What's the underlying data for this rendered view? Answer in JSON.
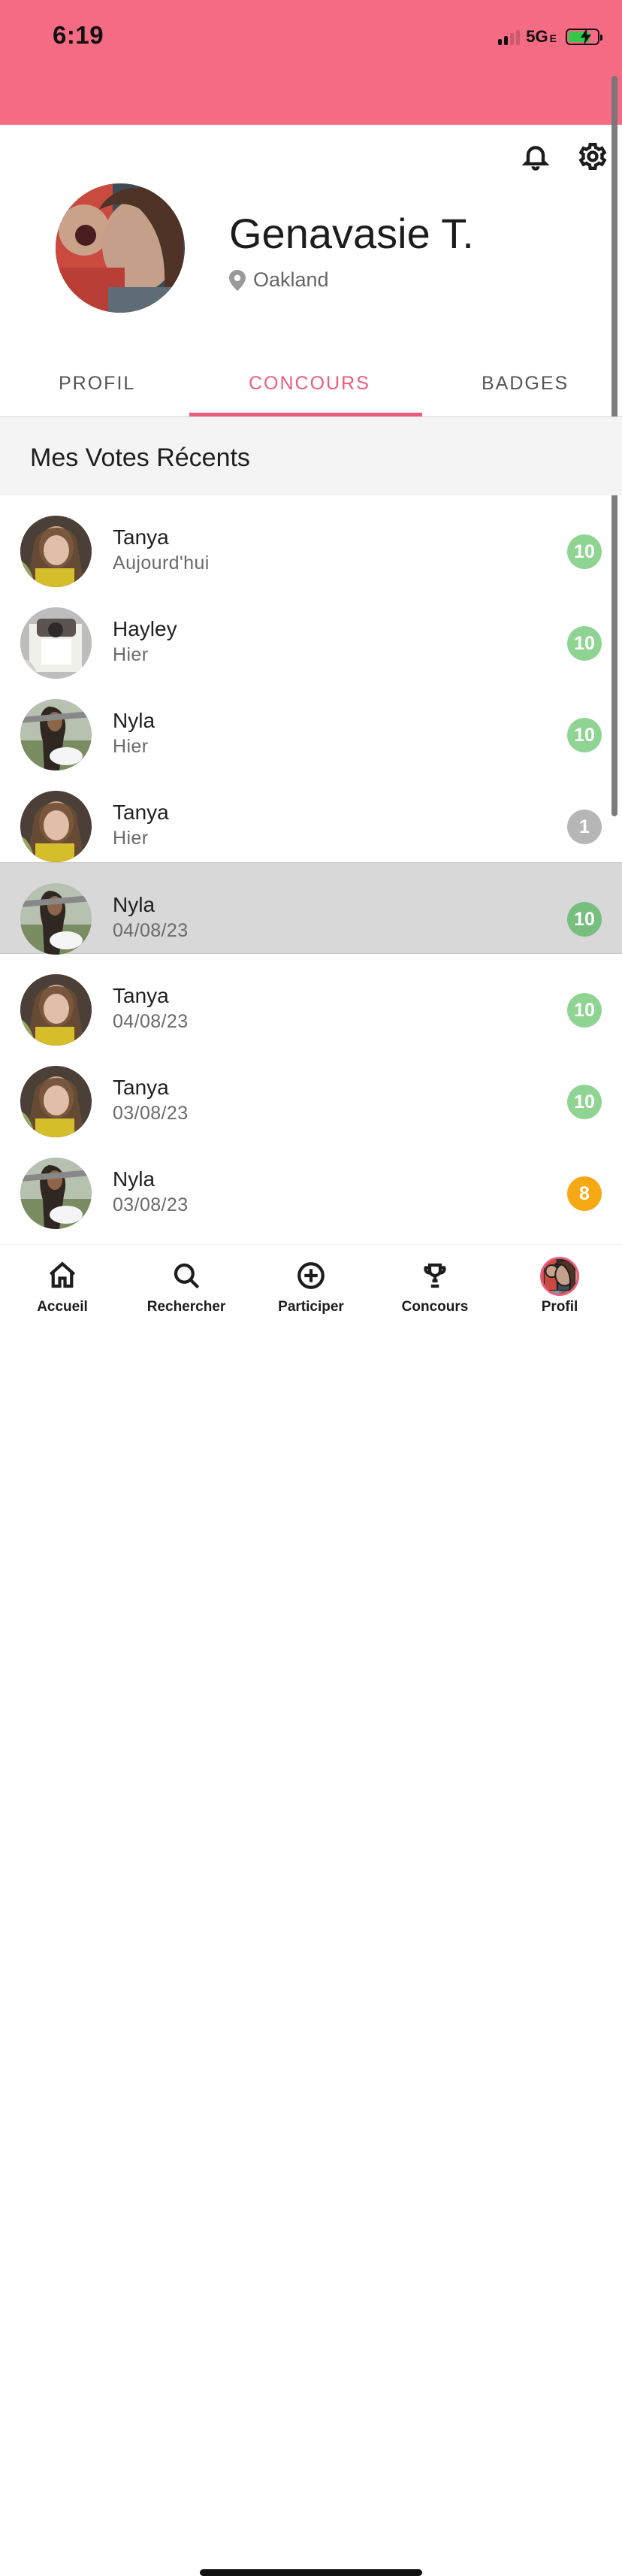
{
  "status_bar": {
    "time": "6:19",
    "network": "5G",
    "network_suffix": "E"
  },
  "header": {
    "notification_icon": "bell-icon",
    "settings_icon": "gear-icon"
  },
  "profile": {
    "name": "Genavasie T.",
    "location": "Oakland"
  },
  "tabs": [
    {
      "label": "PROFIL"
    },
    {
      "label": "CONCOURS"
    },
    {
      "label": "BADGES"
    }
  ],
  "section": {
    "title": "Mes Votes Récents"
  },
  "votes": [
    {
      "name": "Tanya",
      "date": "Aujourd'hui",
      "score": "10",
      "color": "#8fd493"
    },
    {
      "name": "Hayley",
      "date": "Hier",
      "score": "10",
      "color": "#8fd493"
    },
    {
      "name": "Nyla",
      "date": "Hier",
      "score": "10",
      "color": "#8fd493"
    },
    {
      "name": "Tanya",
      "date": "Hier",
      "score": "1",
      "color": "#b6b6b6"
    },
    {
      "name": "Nyla",
      "date": "04/08/23",
      "score": "10",
      "color": "#76bf7f"
    },
    {
      "name": "Tanya",
      "date": "04/08/23",
      "score": "10",
      "color": "#8fd493"
    },
    {
      "name": "Tanya",
      "date": "03/08/23",
      "score": "10",
      "color": "#8fd493"
    },
    {
      "name": "Nyla",
      "date": "03/08/23",
      "score": "8",
      "color": "#f7a915"
    }
  ],
  "bottom_nav": [
    {
      "label": "Accueil",
      "icon": "home-icon"
    },
    {
      "label": "Rechercher",
      "icon": "search-icon"
    },
    {
      "label": "Participer",
      "icon": "plus-circle-icon"
    },
    {
      "label": "Concours",
      "icon": "trophy-icon"
    },
    {
      "label": "Profil",
      "icon": "avatar"
    }
  ],
  "colors": {
    "status_bar": "#f46b83",
    "accent": "#ec5d7b",
    "green_score": "#8fd493",
    "gray_score": "#b6b6b6",
    "orange_score": "#f7a915"
  }
}
